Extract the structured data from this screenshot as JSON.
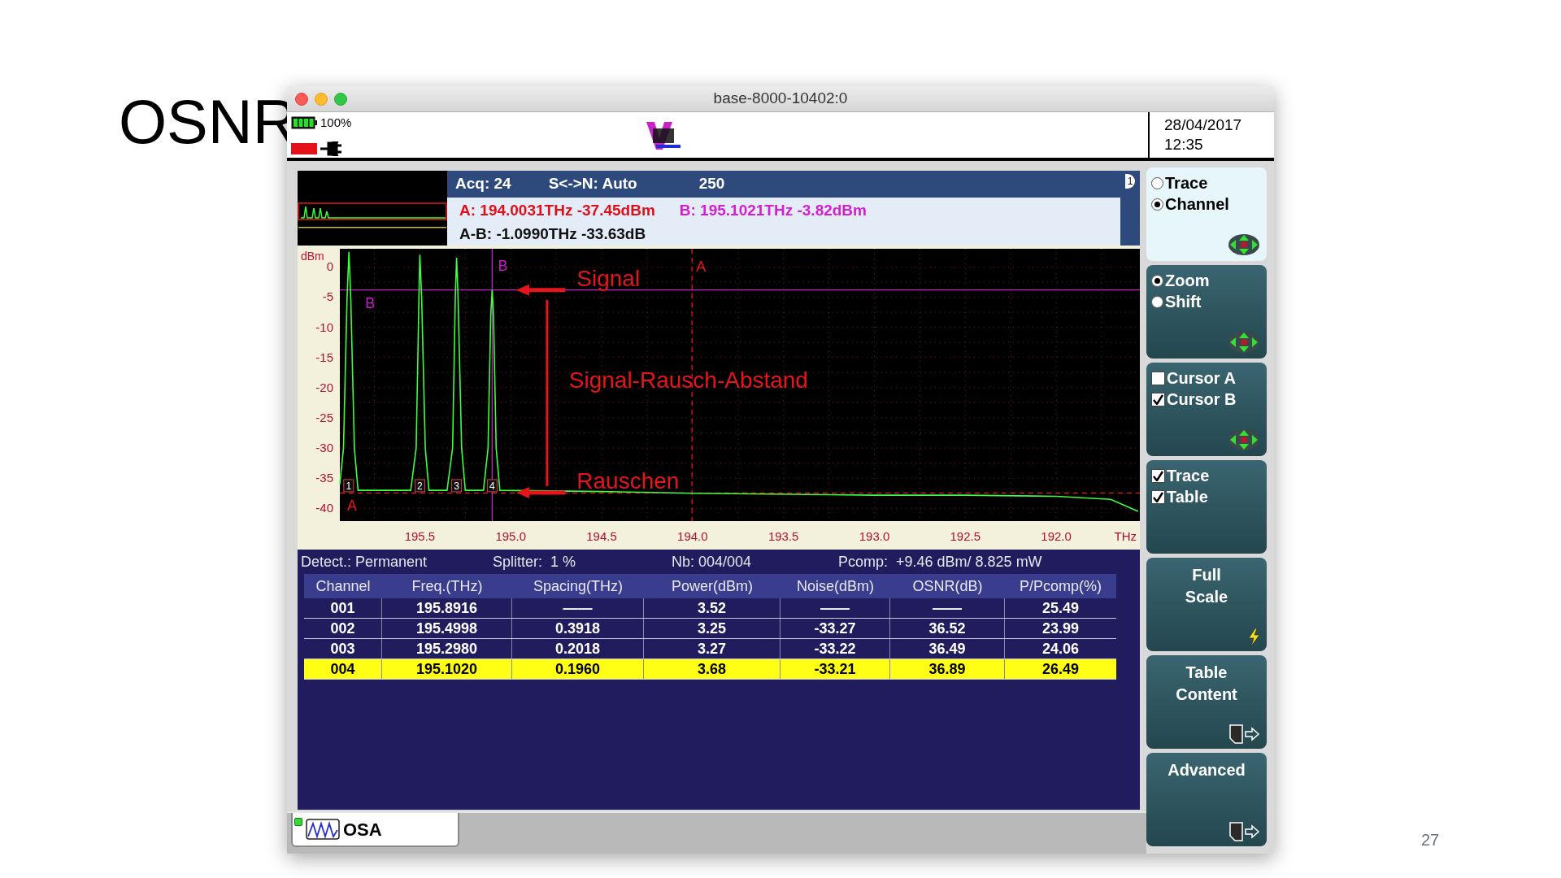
{
  "slide": {
    "title": "OSNR",
    "page_number": "27"
  },
  "window": {
    "title": "base-8000-10402:0"
  },
  "status": {
    "battery": "100%",
    "date": "28/04/2017",
    "time": "12:35"
  },
  "readout": {
    "acq": "Acq: 24",
    "mode": "S<->N: Auto",
    "value": "250",
    "trace_number": "1",
    "cursor_a": "A: 194.0031THz -37.45dBm",
    "cursor_b": "B: 195.1021THz -3.82dBm",
    "delta": "A-B: -1.0990THz -33.63dB"
  },
  "chart_data": {
    "type": "line",
    "xlabel": "THz",
    "ylabel": "dBm",
    "xlim": [
      195.94,
      191.54
    ],
    "ylim": [
      -42.1,
      3
    ],
    "grid": true,
    "xticks": [
      195.5,
      {
        "value": 195,
        "label": "195.0"
      },
      194.5,
      {
        "value": 194,
        "label": "194.0"
      },
      193.5,
      {
        "value": 193,
        "label": "193.0"
      },
      192.5,
      {
        "value": 192,
        "label": "192.0"
      }
    ],
    "yticks": [
      0,
      -5,
      -10,
      -15,
      -20,
      -25,
      -30,
      -35,
      -40
    ],
    "x": [
      195.94,
      195.92,
      195.9,
      195.89,
      195.88,
      195.86,
      195.84,
      195.55,
      195.52,
      195.505,
      195.5,
      195.49,
      195.47,
      195.45,
      195.35,
      195.32,
      195.305,
      195.298,
      195.29,
      195.27,
      195.25,
      195.15,
      195.125,
      195.11,
      195.102,
      195.095,
      195.08,
      195.06,
      194.5,
      194.0,
      193.0,
      192.5,
      192.0,
      191.7,
      191.55
    ],
    "series": [
      {
        "color": "#3cff3c",
        "values": [
          -36,
          -30,
          -5,
          2.5,
          -5,
          -30,
          -37,
          -37,
          -30,
          -5,
          2,
          -5,
          -30,
          -37,
          -37,
          -30,
          -5,
          1.5,
          -5,
          -30,
          -37,
          -37,
          -30,
          -8,
          -3.8,
          -8,
          -30,
          -37,
          -37.2,
          -37.5,
          -37.8,
          -37.8,
          -38,
          -38.5,
          -40.5
        ]
      }
    ],
    "ref_lines": [
      {
        "axis": "y",
        "value": -37.45,
        "color": "#e8141c"
      },
      {
        "axis": "x",
        "value": 194.0031,
        "color": "#e8141c"
      },
      {
        "axis": "y",
        "value": -3.82,
        "color": "#c21fc2"
      },
      {
        "axis": "x",
        "value": 195.1021,
        "color": "#c21fc2"
      }
    ],
    "annotations": [
      "A",
      "A",
      "B",
      "B",
      {
        "text": "1",
        "x": 195.8916,
        "y": -36.3
      },
      {
        "text": "2",
        "x": 195.4998,
        "y": -36.3
      },
      {
        "text": "3",
        "x": 195.298,
        "y": -36.3
      },
      {
        "text": "4",
        "x": 195.1021,
        "y": -36.3
      }
    ]
  },
  "slide_annotations": [
    {
      "kind": "arrow",
      "label": "Signal"
    },
    {
      "kind": "span",
      "label": "Signal-Rausch-Abstand"
    },
    {
      "kind": "arrow",
      "label": "Rauschen"
    }
  ],
  "table_info": [
    "Detect.: Permanent",
    "Splitter:  1 %",
    "Nb: 004/004",
    "Pcomp:  +9.46 dBm/ 8.825 mW"
  ],
  "table": {
    "columns": [
      "Channel",
      "Freq.(THz)",
      "Spacing(THz)",
      "Power(dBm)",
      "Noise(dBm)",
      "OSNR(dB)",
      "P/Pcomp(%)"
    ],
    "rows": [
      {
        "selected": false,
        "cells": [
          "001",
          "195.8916",
          "——",
          "3.52",
          "——",
          "——",
          "25.49"
        ]
      },
      {
        "selected": false,
        "cells": [
          "002",
          "195.4998",
          "0.3918",
          "3.25",
          "-33.27",
          "36.52",
          "23.99"
        ]
      },
      {
        "selected": false,
        "cells": [
          "003",
          "195.2980",
          "0.2018",
          "3.27",
          "-33.22",
          "36.49",
          "24.06"
        ]
      },
      {
        "selected": true,
        "cells": [
          "004",
          "195.1020",
          "0.1960",
          "3.68",
          "-33.21",
          "36.89",
          "26.49"
        ]
      }
    ]
  },
  "softkeys": [
    {
      "kind": "radio",
      "selected": true,
      "nav": true,
      "options": [
        {
          "label": "Trace",
          "selected": false
        },
        {
          "label": "Channel",
          "selected": true
        }
      ]
    },
    {
      "kind": "radio",
      "selected": false,
      "nav": true,
      "options": [
        {
          "label": "Zoom",
          "selected": true
        },
        {
          "label": "Shift",
          "selected": false
        }
      ]
    },
    {
      "kind": "check",
      "selected": false,
      "nav": true,
      "options": [
        {
          "label": "Cursor A",
          "checked": false
        },
        {
          "label": "Cursor B",
          "checked": true
        }
      ]
    },
    {
      "kind": "check",
      "selected": false,
      "nav": false,
      "options": [
        {
          "label": "Trace",
          "checked": true
        },
        {
          "label": "Table",
          "checked": true
        }
      ]
    },
    {
      "kind": "instant",
      "selected": false,
      "lines": [
        "Full",
        "Scale"
      ]
    },
    {
      "kind": "submenu",
      "selected": false,
      "lines": [
        "Table",
        "Content"
      ]
    },
    {
      "kind": "submenu",
      "selected": false,
      "lines": [
        "Advanced"
      ]
    }
  ],
  "tabs": [
    {
      "label": "OSA",
      "selected": true,
      "active": true
    }
  ]
}
